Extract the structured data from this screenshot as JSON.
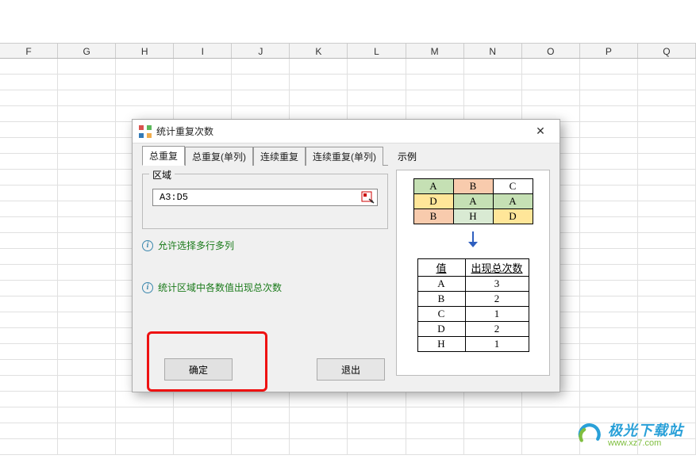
{
  "columns": [
    "F",
    "G",
    "H",
    "I",
    "J",
    "K",
    "L",
    "M",
    "N",
    "O",
    "P",
    "Q"
  ],
  "dialog": {
    "title": "统计重复次数",
    "tabs": [
      "总重复",
      "总重复(单列)",
      "连续重复",
      "连续重复(单列)"
    ],
    "active_tab_index": 0,
    "region_group_label": "区域",
    "range_value": "A3:D5",
    "hint1": "允许选择多行多列",
    "hint2": "统计区域中各数值出现总次数",
    "ok_label": "确定",
    "cancel_label": "退出",
    "close_symbol": "✕"
  },
  "example": {
    "label": "示例",
    "grid": [
      [
        "A",
        "B",
        "C"
      ],
      [
        "D",
        "A",
        "A"
      ],
      [
        "B",
        "H",
        "D"
      ]
    ],
    "result_headers": [
      "值",
      "出现总次数"
    ],
    "result_rows": [
      [
        "A",
        "3"
      ],
      [
        "B",
        "2"
      ],
      [
        "C",
        "1"
      ],
      [
        "D",
        "2"
      ],
      [
        "H",
        "1"
      ]
    ]
  },
  "watermark": {
    "cn": "极光下载站",
    "url": "www.xz7.com"
  }
}
